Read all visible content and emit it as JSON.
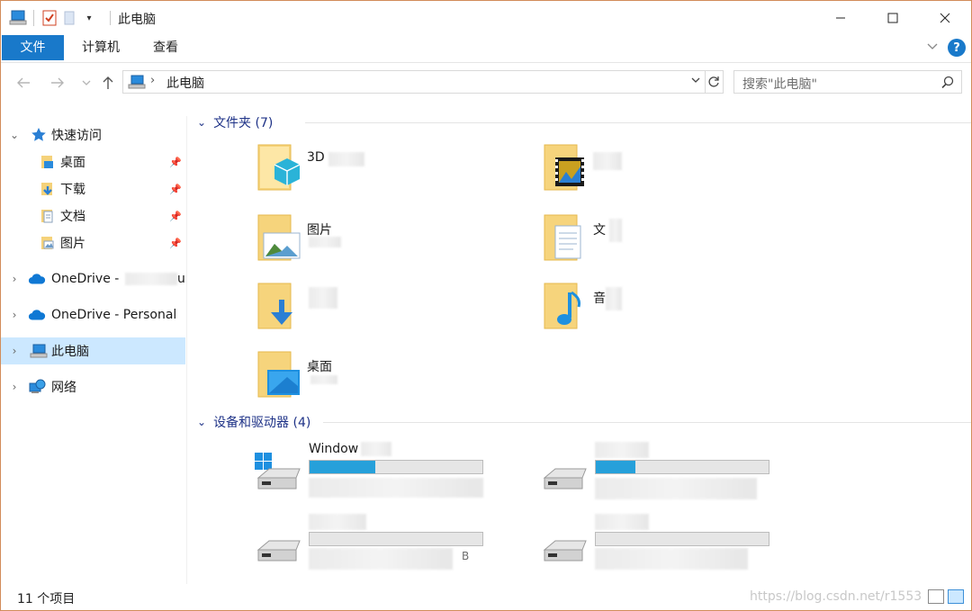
{
  "window": {
    "title": "此电脑"
  },
  "ribbon": {
    "tabs": [
      {
        "label": "文件"
      },
      {
        "label": "计算机"
      },
      {
        "label": "查看"
      }
    ],
    "help": "?"
  },
  "address": {
    "path": "此电脑",
    "search_placeholder": "搜索\"此电脑\""
  },
  "nav": {
    "quick_access": "快速访问",
    "pinned": [
      {
        "label": "桌面"
      },
      {
        "label": "下载"
      },
      {
        "label": "文档"
      },
      {
        "label": "图片"
      }
    ],
    "onedrive_business": "OneDrive -",
    "onedrive_business_suffix": "u",
    "onedrive_personal": "OneDrive - Personal",
    "this_pc": "此电脑",
    "network": "网络"
  },
  "content": {
    "folders_header": "文件夹 (7)",
    "folders": [
      {
        "name": "3D",
        "icon": "3d-objects-icon"
      },
      {
        "name": "",
        "icon": "videos-icon"
      },
      {
        "name": "图片",
        "icon": "pictures-icon"
      },
      {
        "name": "文",
        "icon": "documents-icon"
      },
      {
        "name": "",
        "icon": "downloads-icon"
      },
      {
        "name": "音",
        "icon": "music-icon"
      },
      {
        "name": "桌面",
        "icon": "desktop-icon"
      }
    ],
    "drives_header": "设备和驱动器 (4)",
    "drives": [
      {
        "name": "Window",
        "info": "",
        "used": 0.38,
        "windows_logo": true
      },
      {
        "name": "",
        "info": "",
        "used": 0.23,
        "windows_logo": false
      },
      {
        "name": "",
        "info": "B",
        "used": 0,
        "windows_logo": false
      },
      {
        "name": "",
        "info": "",
        "used": 0,
        "windows_logo": false
      }
    ]
  },
  "status": {
    "count": "11 个项目",
    "watermark": "https://blog.csdn.net/r1553"
  },
  "colors": {
    "accent": "#1979ca",
    "selected_bg": "#cce8ff",
    "group_header": "#1e3287",
    "drive_fill": "#26a0da",
    "window_border": "#d28c5a"
  }
}
